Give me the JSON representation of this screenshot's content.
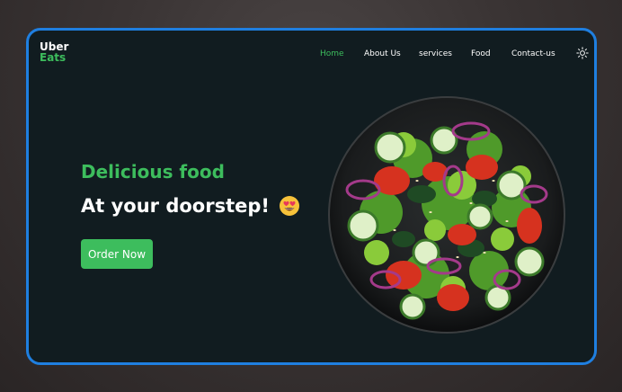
{
  "brand": {
    "line1": "Uber",
    "line2": "Eats"
  },
  "nav": {
    "items": [
      {
        "label": "Home",
        "active": true
      },
      {
        "label": "About Us",
        "active": false
      },
      {
        "label": "services",
        "active": false
      },
      {
        "label": "Food",
        "active": false
      },
      {
        "label": "Contact-us",
        "active": false
      }
    ],
    "theme_toggle_icon": "sun-icon"
  },
  "hero": {
    "title": "Delicious food",
    "subtitle": "At your doorstep!",
    "emoji_icon": "heart-eyes-emoji",
    "cta_label": "Order Now",
    "image_icon": "salad-bowl-image"
  },
  "colors": {
    "accent": "#3dbd5d",
    "background": "#111c20",
    "frame_border": "#1f7fe0",
    "text": "#ffffff"
  }
}
